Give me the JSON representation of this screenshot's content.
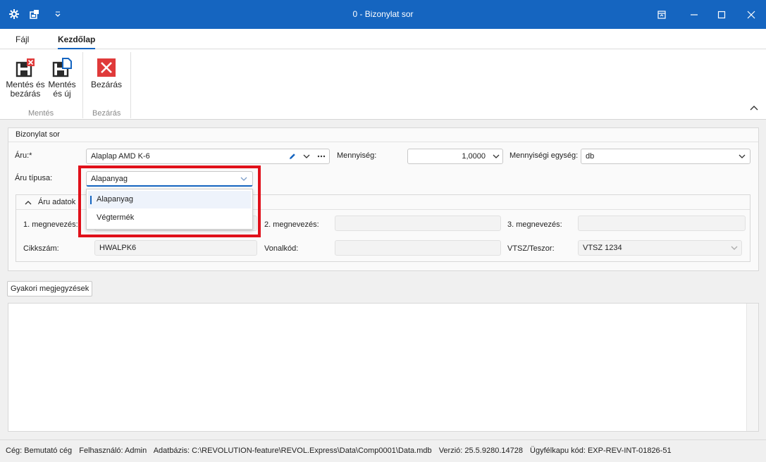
{
  "window": {
    "title": "0 - Bizonylat sor",
    "icons": [
      "settings-icon",
      "layout-icon",
      "quick-access-dropdown-icon"
    ],
    "controls": [
      "pin-icon",
      "minimize-icon",
      "maximize-icon",
      "close-icon"
    ]
  },
  "menu": {
    "tabs": [
      {
        "label": "Fájl",
        "active": false
      },
      {
        "label": "Kezdőlap",
        "active": true
      }
    ]
  },
  "ribbon": {
    "groups": [
      {
        "label": "Mentés",
        "buttons": [
          {
            "line1": "Mentés és",
            "line2": "bezárás",
            "icon": "save-close-icon"
          },
          {
            "line1": "Mentés",
            "line2": "és új",
            "icon": "save-new-icon"
          }
        ]
      },
      {
        "label": "Bezárás",
        "buttons": [
          {
            "line1": "Bezárás",
            "icon": "close-red-icon"
          }
        ]
      }
    ],
    "collapse_icon": "chevron-up-icon"
  },
  "form": {
    "section_title": "Bizonylat sor",
    "aru_label": "Áru:*",
    "aru_value": "Alaplap AMD K-6",
    "mennyiseg_label": "Mennyiség:",
    "mennyiseg_value": "1,0000",
    "egyseg_label": "Mennyiségi egység:",
    "egyseg_value": "db",
    "tipus_label": "Áru típusa:",
    "tipus_value": "Alapanyag",
    "tipus_options": [
      "Alapanyag",
      "Végtermék"
    ],
    "tipus_selected": "Alapanyag"
  },
  "aru_adatok": {
    "title": "Áru adatok",
    "megnev1_label": "1. megnevezés:",
    "megnev2_label": "2. megnevezés:",
    "megnev3_label": "3. megnevezés:",
    "megnev1_value": "",
    "megnev2_value": "",
    "megnev3_value": "",
    "cikkszam_label": "Cikkszám:",
    "cikkszam_value": "HWALPK6",
    "vonalkod_label": "Vonalkód:",
    "vonalkod_value": "",
    "vtsz_label": "VTSZ/Teszor:",
    "vtsz_value": "VTSZ 1234"
  },
  "notes": {
    "button_label": "Gyakori megjegyzések",
    "content": ""
  },
  "status": {
    "ceg": "Cég: Bemutató cég",
    "felhasznalo": "Felhasználó: Admin",
    "adatbazis": "Adatbázis: C:\\REVOLUTION-feature\\REVOL.Express\\Data\\Comp0001\\Data.mdb",
    "verzio": "Verzió: 25.5.9280.14728",
    "ugyfelkapu": "Ügyfélkapu kód: EXP-REV-INT-01826-51"
  },
  "colors": {
    "titlebar": "#1565c0",
    "highlight": "#e0101a",
    "close_red": "#e03a3a"
  }
}
